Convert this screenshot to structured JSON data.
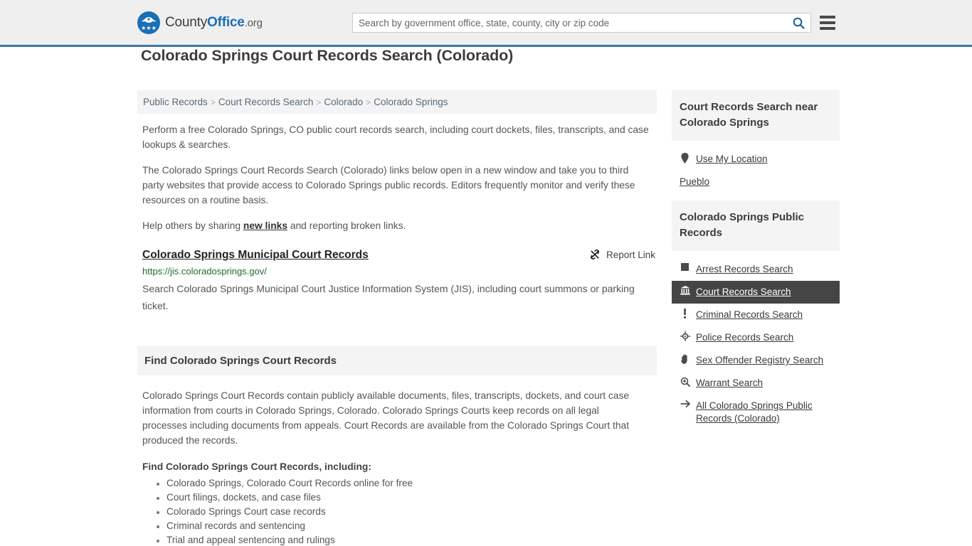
{
  "header": {
    "logo": {
      "part1": "County",
      "part2": "Office",
      "part3": ".org",
      "icon": "eagle-seal-icon",
      "stars": "★★★"
    },
    "search": {
      "placeholder": "Search by government office, state, county, city or zip code",
      "value": "",
      "icon": "search-icon"
    },
    "menu_icon": "hamburger-menu-icon",
    "accent_color": "#3b77ab"
  },
  "page": {
    "title": "Colorado Springs Court Records Search (Colorado)"
  },
  "breadcrumb": {
    "items": [
      {
        "label": "Public Records"
      },
      {
        "label": "Court Records Search"
      },
      {
        "label": "Colorado"
      },
      {
        "label": "Colorado Springs"
      }
    ],
    "separator": ">"
  },
  "intro": {
    "p1": "Perform a free Colorado Springs, CO public court records search, including court dockets, files, transcripts, and case lookups & searches.",
    "p2": "The Colorado Springs Court Records Search (Colorado) links below open in a new window and take you to third party websites that provide access to Colorado Springs public records. Editors frequently monitor and verify these resources on a routine basis.",
    "p3_before": "Help others by sharing ",
    "p3_link": "new links",
    "p3_after": " and reporting broken links."
  },
  "result": {
    "title": "Colorado Springs Municipal Court Records",
    "url": "https://jis.coloradosprings.gov/",
    "description": "Search Colorado Springs Municipal Court Justice Information System (JIS), including court summons or parking ticket.",
    "report_label": "Report Link",
    "report_icon": "broken-link-icon",
    "url_color": "#1d6b2e"
  },
  "find_section": {
    "heading": "Find Colorado Springs Court Records",
    "body": "Colorado Springs Court Records contain publicly available documents, files, transcripts, dockets, and court case information from courts in Colorado Springs, Colorado. Colorado Springs Courts keep records on all legal processes including documents from appeals. Court Records are available from the Colorado Springs Court that produced the records.",
    "subheading": "Find Colorado Springs Court Records, including:",
    "items": [
      "Colorado Springs, Colorado Court Records online for free",
      "Court filings, dockets, and case files",
      "Colorado Springs Court case records",
      "Criminal records and sentencing",
      "Trial and appeal sentencing and rulings"
    ]
  },
  "sidebar": {
    "near_box": {
      "heading": "Court Records Search near Colorado Springs",
      "use_location": {
        "label": "Use My Location",
        "icon": "map-pin-icon"
      },
      "nearby": [
        {
          "label": "Pueblo"
        }
      ]
    },
    "public_records_box": {
      "heading": "Colorado Springs Public Records",
      "items": [
        {
          "label": "Arrest Records Search",
          "icon": "handcuffs-square-icon",
          "active": false
        },
        {
          "label": "Court Records Search",
          "icon": "courthouse-icon",
          "active": true
        },
        {
          "label": "Criminal Records Search",
          "icon": "exclamation-icon",
          "active": false
        },
        {
          "label": "Police Records Search",
          "icon": "police-badge-icon",
          "active": false
        },
        {
          "label": "Sex Offender Registry Search",
          "icon": "hand-icon",
          "active": false
        },
        {
          "label": "Warrant Search",
          "icon": "magnifier-plus-icon",
          "active": false
        }
      ],
      "all_link": {
        "label": "All Colorado Springs Public Records (Colorado)",
        "icon": "arrow-right-icon"
      },
      "active_bg": "#454545"
    }
  }
}
